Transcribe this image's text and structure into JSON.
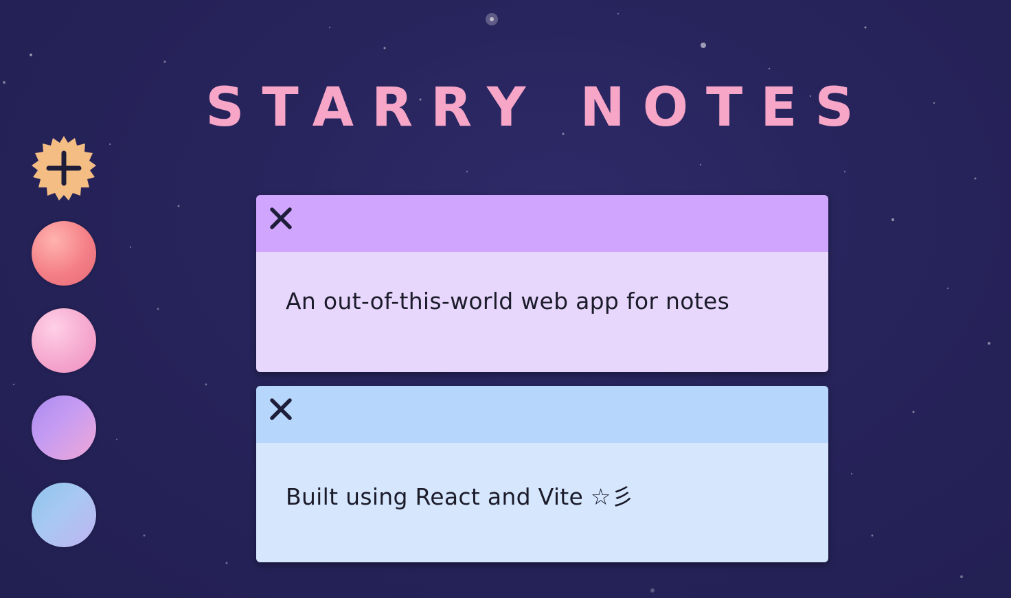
{
  "app": {
    "title": "STARRY NOTES"
  },
  "toolbar": {
    "add_icon": "plus-icon",
    "add_color": "#f4bd84",
    "swatches": [
      {
        "name": "red",
        "color": "#f47f86"
      },
      {
        "name": "pink",
        "color": "#f5a9cf"
      },
      {
        "name": "purple",
        "color": "#c79cf2"
      },
      {
        "name": "blue",
        "color": "#a8c8f2"
      }
    ]
  },
  "notes": [
    {
      "text": "An out-of-this-world web app for notes",
      "header_color": "#d0a5fd",
      "body_color": "#e8d7fc",
      "close_icon": "close-icon"
    },
    {
      "text": "Built using React and Vite ☆彡",
      "header_color": "#b6d6fb",
      "body_color": "#d5e6fd",
      "close_icon": "close-icon"
    }
  ],
  "colors": {
    "background": "#27245c",
    "title": "#f7a6c8"
  }
}
